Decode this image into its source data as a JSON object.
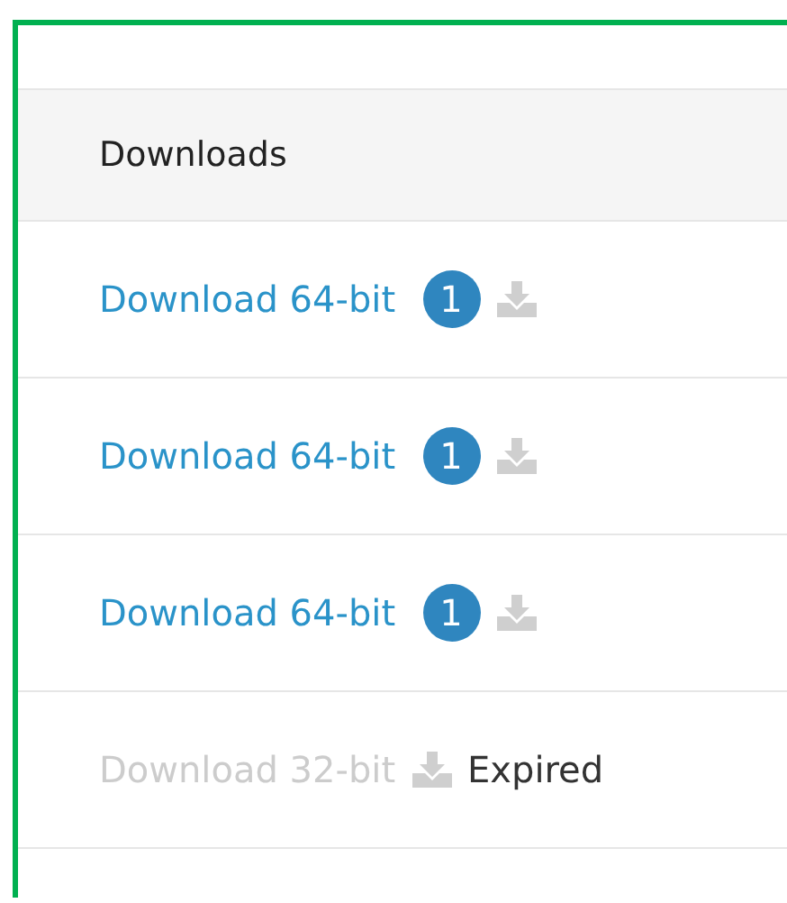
{
  "table": {
    "header": "Downloads",
    "rows": [
      {
        "label": "Download 64-bit",
        "disabled": false,
        "badge": "1"
      },
      {
        "label": "Download 64-bit",
        "disabled": false,
        "badge": "1"
      },
      {
        "label": "Download 64-bit",
        "disabled": false,
        "badge": "1"
      },
      {
        "label": "Download 32-bit",
        "disabled": true,
        "status": "Expired"
      }
    ]
  }
}
